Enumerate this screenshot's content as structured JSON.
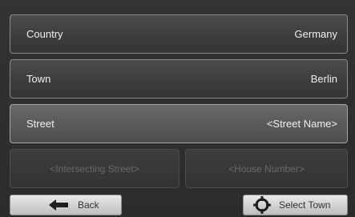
{
  "fields": [
    {
      "label": "Country",
      "value": "Germany"
    },
    {
      "label": "Town",
      "value": "Berlin"
    },
    {
      "label": "Street",
      "value": "<Street Name>"
    }
  ],
  "secondary": {
    "intersecting": "<Intersecting Street>",
    "house_number": "<House Number>"
  },
  "footer": {
    "back_label": "Back",
    "back_icon": "arrow-left-icon",
    "select_label": "Select Town",
    "select_icon": "crosshair-icon"
  }
}
